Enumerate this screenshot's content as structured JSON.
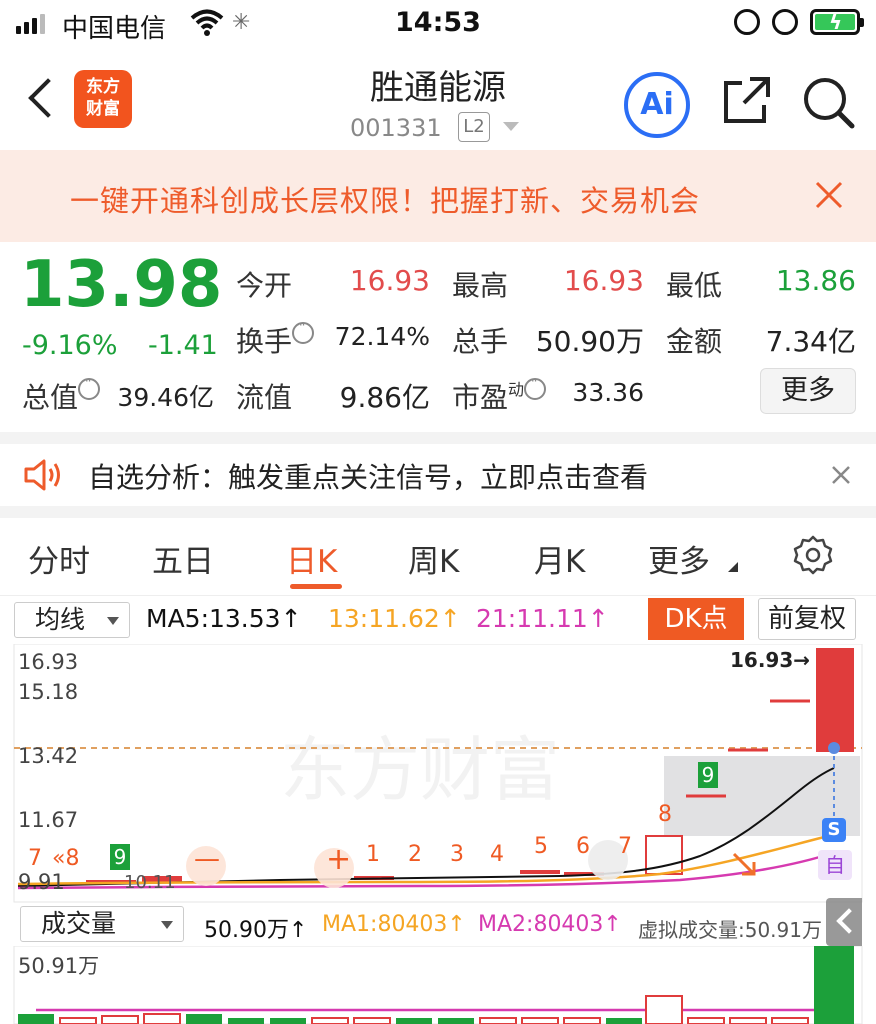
{
  "status_bar": {
    "carrier": "中国电信",
    "time": "14:53"
  },
  "header": {
    "logo_text": "东方财富",
    "stock_name": "胜通能源",
    "stock_code": "001331",
    "level_badge": "L2",
    "ai_label": "Ai"
  },
  "promo": {
    "text": "一键开通科创成长层权限！把握打新、交易机会"
  },
  "quote": {
    "price": "13.98",
    "change_pct": "-9.16%",
    "change_abs": "-1.41",
    "open_label": "今开",
    "open_value": "16.93",
    "high_label": "最高",
    "high_value": "16.93",
    "low_label": "最低",
    "low_value": "13.86",
    "turnover_label": "换手",
    "turnover_value": "72.14%",
    "volume_label": "总手",
    "volume_value": "50.90万",
    "amount_label": "金额",
    "amount_value": "7.34亿",
    "mktcap_label": "总值",
    "mktcap_value": "39.46亿",
    "float_label": "流值",
    "float_value": "9.86亿",
    "pe_label": "市盈",
    "pe_sup": "动",
    "pe_value": "33.36",
    "more_label": "更多"
  },
  "alert": {
    "text": "自选分析：触发重点关注信号，立即点击查看"
  },
  "tabs": [
    {
      "label": "分时"
    },
    {
      "label": "五日"
    },
    {
      "label": "日K"
    },
    {
      "label": "周K"
    },
    {
      "label": "月K"
    },
    {
      "label": "更多"
    }
  ],
  "indicator": {
    "selector": "均线",
    "ma5": "MA5:13.53↑",
    "ma13": "13:11.62↑",
    "ma21": "21:11.11↑",
    "dk_label": "DK点",
    "fq_label": "前复权"
  },
  "chart_data": {
    "type": "candlestick",
    "y_ticks": [
      "16.93",
      "15.18",
      "13.42",
      "11.67",
      "9.91"
    ],
    "high_label": "16.93→",
    "low_label": "10.11",
    "current_price_line": "13.42",
    "sequence_labels": [
      "7",
      "8",
      "9",
      "1",
      "2",
      "3",
      "4",
      "5",
      "6",
      "7",
      "8",
      "9"
    ],
    "minus_marker": "—",
    "plus_marker": "+",
    "signal_s": "S",
    "signal_zi": "自",
    "colors": {
      "up": "#e03c3c",
      "down": "#1ca03a",
      "ma5": "#111111",
      "ma13": "#f5a524",
      "ma21": "#d63ab0",
      "zone": "#d9d9dc"
    }
  },
  "volume": {
    "selector": "成交量",
    "value_text": "50.90万↑",
    "ma1": "MA1:80403↑",
    "ma2": "MA2:80403↑",
    "virtual": "虚拟成交量:50.91万",
    "y_label": "50.91万"
  }
}
